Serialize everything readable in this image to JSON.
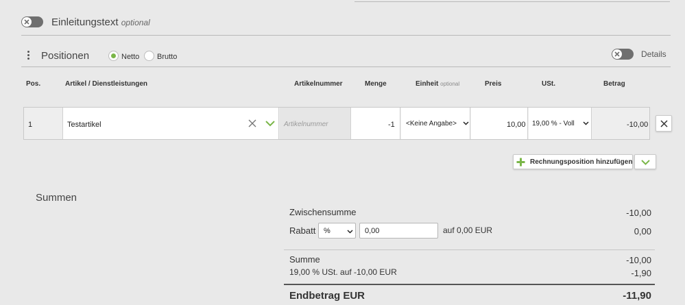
{
  "intro": {
    "title": "Einleitungstext",
    "optional": "optional"
  },
  "positions": {
    "title": "Positionen",
    "netto_label": "Netto",
    "brutto_label": "Brutto",
    "details_label": "Details",
    "selected_mode": "Netto"
  },
  "table": {
    "headers": {
      "pos": "Pos.",
      "artikel": "Artikel / Dienstleistungen",
      "artikelnummer": "Artikelnummer",
      "menge": "Menge",
      "einheit": "Einheit",
      "einheit_optional": "optional",
      "preis": "Preis",
      "ust": "USt.",
      "betrag": "Betrag"
    },
    "row": {
      "pos": "1",
      "artikel": "Testartikel",
      "artikelnummer_placeholder": "Artikelnummer",
      "menge": "-1",
      "einheit": "<Keine Angabe>",
      "preis": "10,00",
      "ust": "19,00 % - Voll",
      "betrag": "-10,00"
    }
  },
  "add_button": {
    "label": "Rechnungsposition hinzufügen"
  },
  "summen": {
    "title": "Summen",
    "zwischensumme_label": "Zwischensumme",
    "zwischensumme_value": "-10,00",
    "rabatt_label": "Rabatt",
    "rabatt_type": "%",
    "rabatt_input": "0,00",
    "rabatt_auf": "auf 0,00 EUR",
    "rabatt_value": "0,00",
    "summe_label": "Summe",
    "summe_value": "-10,00",
    "ust_label": "19,00 % USt. auf -10,00 EUR",
    "ust_value": "-1,90",
    "endbetrag_label": "Endbetrag EUR",
    "endbetrag_value": "-11,90"
  },
  "colors": {
    "accent_green": "#7ab648",
    "toggle_gray": "#6f6f6f"
  }
}
